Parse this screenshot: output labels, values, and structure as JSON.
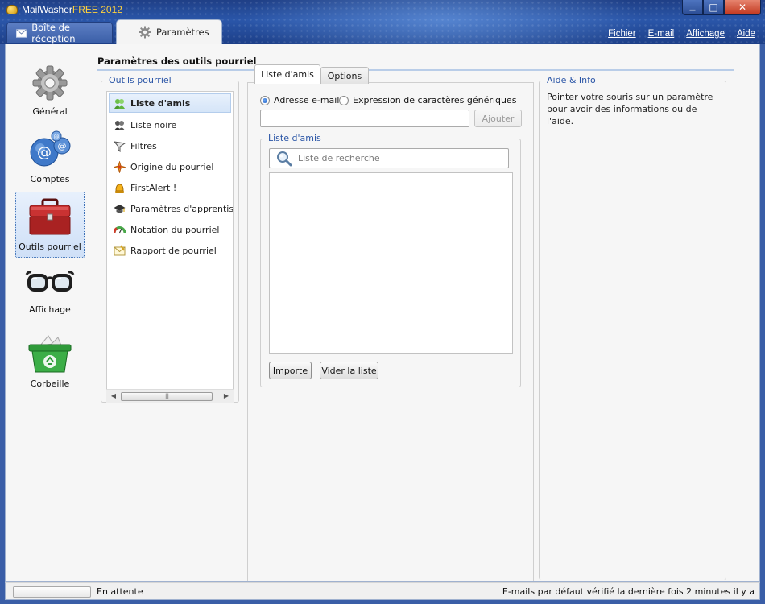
{
  "window": {
    "title_prefix": "MailWasher",
    "title_suffix": "FREE 2012",
    "minimize_glyph": "▁",
    "maximize_glyph": "□",
    "close_glyph": "✕"
  },
  "top_tabs": [
    {
      "label": "Boîte de réception",
      "icon": "envelope-icon"
    },
    {
      "label": "Paramètres",
      "icon": "gear-icon",
      "active": true
    }
  ],
  "menu": [
    "Fichier",
    "E-mail",
    "Affichage",
    "Aide"
  ],
  "nav": [
    {
      "label": "Général",
      "icon": "gear-icon"
    },
    {
      "label": "Comptes",
      "icon": "at-sign-icon"
    },
    {
      "label": "Outils pourriel",
      "icon": "toolbox-icon",
      "selected": true
    },
    {
      "label": "Affichage",
      "icon": "glasses-icon"
    },
    {
      "label": "Corbeille",
      "icon": "recycle-bin-icon"
    }
  ],
  "section": {
    "title": "Paramètres des outils pourriel"
  },
  "tools": {
    "legend": "Outils pourriel",
    "items": [
      {
        "label": "Liste d'amis",
        "icon": "friends-icon",
        "selected": true
      },
      {
        "label": "Liste noire",
        "icon": "blacklist-icon"
      },
      {
        "label": "Filtres",
        "icon": "filter-icon"
      },
      {
        "label": "Origine du pourriel",
        "icon": "spam-origin-icon"
      },
      {
        "label": "FirstAlert !",
        "icon": "alert-icon"
      },
      {
        "label": "Paramètres d'apprentissage",
        "icon": "graduation-cap-icon"
      },
      {
        "label": "Notation du pourriel",
        "icon": "gauge-icon"
      },
      {
        "label": "Rapport de pourriel",
        "icon": "report-icon"
      }
    ]
  },
  "center_tabs": [
    {
      "label": "Liste d'amis",
      "active": true
    },
    {
      "label": "Options"
    }
  ],
  "friends": {
    "radio_email": "Adresse e-mail",
    "radio_expr": "Expression de caractères génériques",
    "email_value": "",
    "add_button": "Ajouter",
    "legend": "Liste d'amis",
    "search_placeholder": "Liste de recherche",
    "import_button": "Importe",
    "clear_button": "Vider la liste"
  },
  "help": {
    "legend": "Aide & Info",
    "text": "Pointer votre souris sur un paramètre pour avoir des informations ou de l'aide."
  },
  "status": {
    "left": "En attente",
    "right": "E-mails par défaut vérifié la dernière fois 2 minutes il y a"
  }
}
